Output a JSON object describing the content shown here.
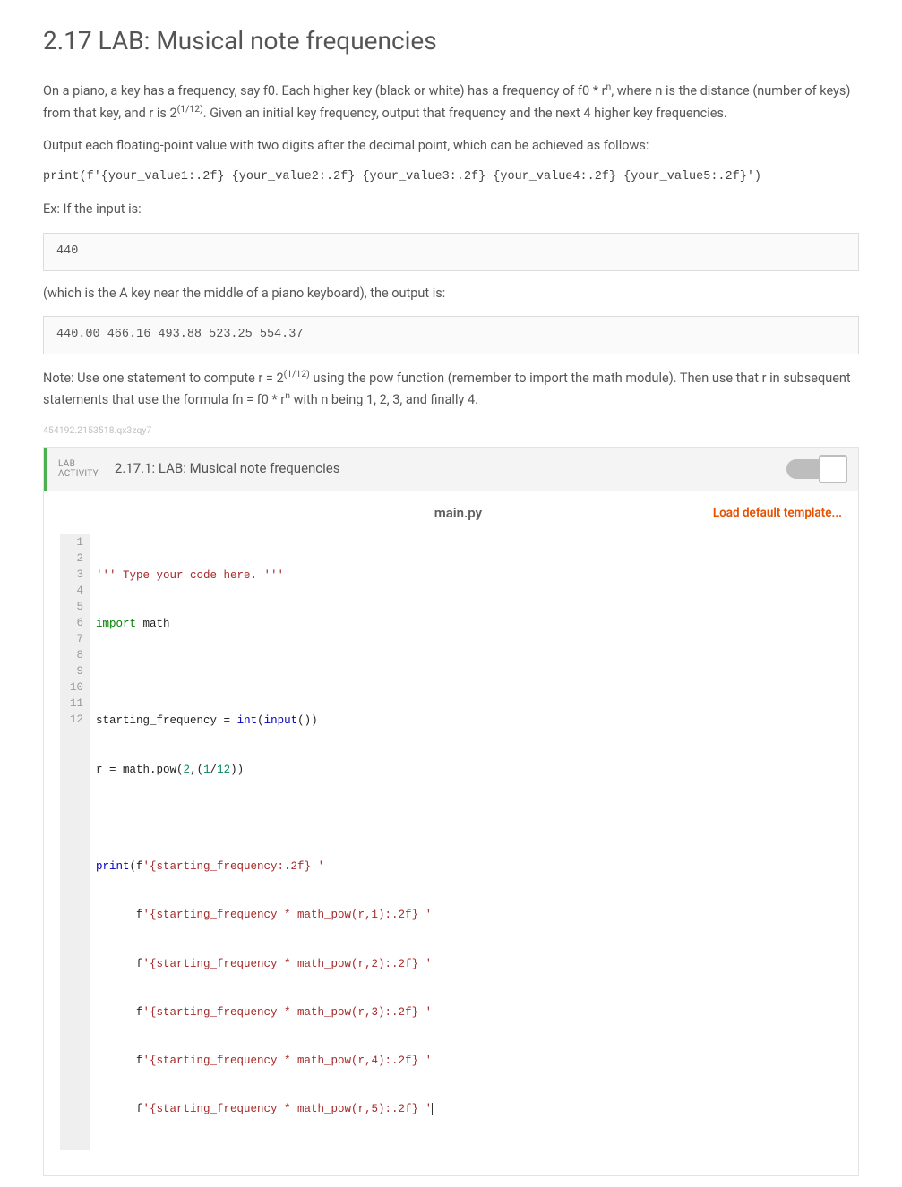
{
  "title": "2.17 LAB: Musical note frequencies",
  "para1_a": "On a piano, a key has a frequency, say f0. Each higher key (black or white) has a frequency of f0 * r",
  "para1_sup1": "n",
  "para1_b": ", where n is the distance (number of keys) from that key, and r is 2",
  "para1_sup2": "(1/12)",
  "para1_c": ". Given an initial key frequency, output that frequency and the next 4 higher key frequencies.",
  "para2": "Output each floating-point value with two digits after the decimal point, which can be achieved as follows:",
  "print_example": "print(f'{your_value1:.2f} {your_value2:.2f} {your_value3:.2f} {your_value4:.2f} {your_value5:.2f}')",
  "ex_label": "Ex: If the input is:",
  "input_block": "440",
  "which_is": "(which is the A key near the middle of a piano keyboard), the output is:",
  "output_block": "440.00 466.16 493.88 523.25 554.37",
  "note_a": "Note: Use one statement to compute r = 2",
  "note_sup": "(1/12)",
  "note_b": " using the pow function (remember to import the math module). Then use that r in subsequent statements that use the formula fn = f0 * r",
  "note_sup2": "n",
  "note_c": " with n being 1, 2, 3, and finally 4.",
  "meta": "454192.2153518.qx3zqy7",
  "lab_badge_l1": "LAB",
  "lab_badge_l2": "ACTIVITY",
  "lab_title": "2.17.1: LAB: Musical note frequencies",
  "filename": "main.py",
  "load_template": "Load default template...",
  "code": {
    "l1_a": "''' Type your code here. '''",
    "l2_a": "import",
    "l2_b": " math",
    "l3": "",
    "l4_a": "starting_frequency ",
    "l4_b": "=",
    "l4_c": " ",
    "l4_d": "int",
    "l4_e": "(",
    "l4_f": "input",
    "l4_g": "())",
    "l5_a": "r ",
    "l5_b": "=",
    "l5_c": " math.pow(",
    "l5_d": "2",
    "l5_e": ",(",
    "l5_f": "1",
    "l5_g": "/",
    "l5_h": "12",
    "l5_i": "))",
    "l6": "",
    "l7_a": "print",
    "l7_b": "(f",
    "l7_c": "'{starting_frequency:.2f} '",
    "l8_a": "      f",
    "l8_b": "'{starting_frequency * math_pow(r,1):.2f} '",
    "l9_a": "      f",
    "l9_b": "'{starting_frequency * math_pow(r,2):.2f} '",
    "l10_a": "      f",
    "l10_b": "'{starting_frequency * math_pow(r,3):.2f} '",
    "l11_a": "      f",
    "l11_b": "'{starting_frequency * math_pow(r,4):.2f} '",
    "l12_a": "      f",
    "l12_b": "'{starting_frequency * math_pow(r,5):.2f} '"
  },
  "gutter": [
    "1",
    "2",
    "3",
    "4",
    "5",
    "6",
    "7",
    "8",
    "9",
    "10",
    "11",
    "12"
  ]
}
